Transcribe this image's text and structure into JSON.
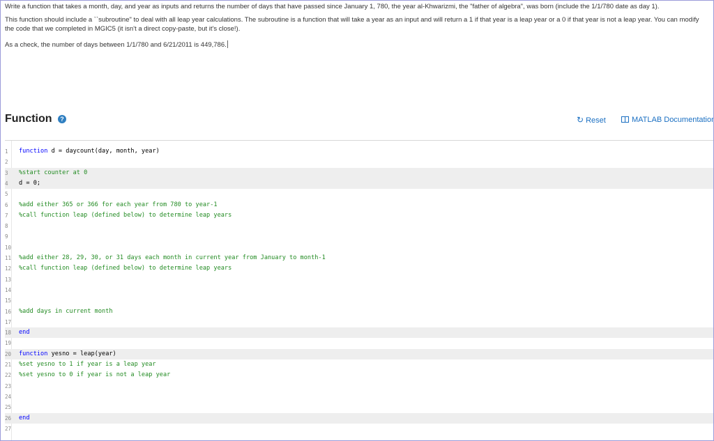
{
  "problem": {
    "p1": "Write a function that takes a month, day, and year as inputs and returns the number of days that have passed since January 1, 780, the year al-Khwarizmi, the \"father of algebra\", was born (include the 1/1/780 date as day 1).",
    "p2": "This function should include a ``subroutine\" to deal with all leap year calculations. The subroutine is a function that will take a year as an input and will return a 1 if that year is a leap year or a 0 if that year is not a leap year.  You can modify the code that we completed in MGIC5 (it isn't a direct copy-paste, but it's close!).",
    "p3": "As a check, the number of days between 1/1/780 and 6/21/2011 is 449,786."
  },
  "header": {
    "title": "Function",
    "help_icon": "question-circle-icon",
    "reset_label": "Reset",
    "reset_icon": "refresh-icon",
    "docs_label": "MATLAB Documentation",
    "docs_icon": "book-icon"
  },
  "colors": {
    "keyword": "#0000ff",
    "comment": "#228b22",
    "link": "#1a6fc2",
    "highlight": "#eeeeee"
  },
  "code": [
    {
      "n": "1",
      "kind": "kw",
      "kw": "function",
      "text": " d = daycount(day, month, year)",
      "hl": false
    },
    {
      "n": "2",
      "kind": "blank",
      "text": "",
      "hl": false
    },
    {
      "n": "3",
      "kind": "cm",
      "text": "%start counter at 0",
      "hl": true
    },
    {
      "n": "4",
      "kind": "pl",
      "text": "d = 0;",
      "hl": true
    },
    {
      "n": "5",
      "kind": "blank",
      "text": "",
      "hl": false
    },
    {
      "n": "6",
      "kind": "cm",
      "text": "%add either 365 or 366 for each year from 780 to year-1",
      "hl": false
    },
    {
      "n": "7",
      "kind": "cm",
      "text": "%call function leap (defined below) to determine leap years",
      "hl": false
    },
    {
      "n": "8",
      "kind": "blank",
      "text": "",
      "hl": false
    },
    {
      "n": "9",
      "kind": "blank",
      "text": "",
      "hl": false
    },
    {
      "n": "10",
      "kind": "blank",
      "text": "",
      "hl": false
    },
    {
      "n": "11",
      "kind": "cm",
      "text": "%add either 28, 29, 30, or 31 days each month in current year from January to month-1",
      "hl": false
    },
    {
      "n": "12",
      "kind": "cm",
      "text": "%call function leap (defined below) to determine leap years",
      "hl": false
    },
    {
      "n": "13",
      "kind": "blank",
      "text": "",
      "hl": false
    },
    {
      "n": "14",
      "kind": "blank",
      "text": "",
      "hl": false
    },
    {
      "n": "15",
      "kind": "blank",
      "text": "",
      "hl": false
    },
    {
      "n": "16",
      "kind": "cm",
      "text": "%add days in current month",
      "hl": false
    },
    {
      "n": "17",
      "kind": "blank",
      "text": "",
      "hl": false
    },
    {
      "n": "18",
      "kind": "kw",
      "kw": "end",
      "text": "",
      "hl": true
    },
    {
      "n": "19",
      "kind": "blank",
      "text": "",
      "hl": false
    },
    {
      "n": "20",
      "kind": "kw",
      "kw": "function",
      "text": " yesno = leap(year)",
      "hl": true
    },
    {
      "n": "21",
      "kind": "cm",
      "text": "%set yesno to 1 if year is a leap year",
      "hl": false
    },
    {
      "n": "22",
      "kind": "cm",
      "text": "%set yesno to 0 if year is not a leap year",
      "hl": false
    },
    {
      "n": "23",
      "kind": "blank",
      "text": "",
      "hl": false
    },
    {
      "n": "24",
      "kind": "blank",
      "text": "",
      "hl": false
    },
    {
      "n": "25",
      "kind": "blank",
      "text": "",
      "hl": false
    },
    {
      "n": "26",
      "kind": "kw",
      "kw": "end",
      "text": "",
      "hl": true
    },
    {
      "n": "27",
      "kind": "blank",
      "text": "",
      "hl": false
    }
  ]
}
